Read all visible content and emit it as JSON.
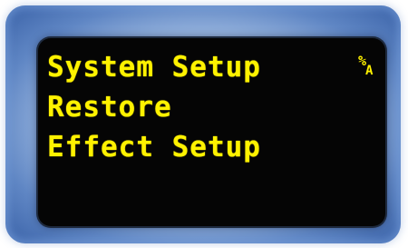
{
  "display": {
    "lines": [
      "System Setup",
      "Restore",
      "Effect Setup"
    ],
    "indicator": {
      "top": "%",
      "bottom": "A",
      "icon": "percent-a-indicator-icon"
    }
  },
  "colors": {
    "text": "#fff200",
    "screen_background": "#050505",
    "bezel": "#5f86c4"
  }
}
